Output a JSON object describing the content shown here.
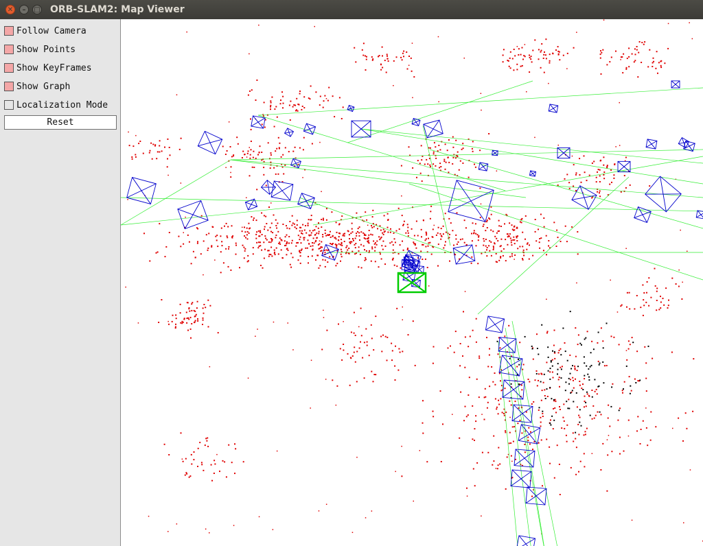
{
  "window": {
    "title": "ORB-SLAM2: Map Viewer"
  },
  "panel": {
    "items": [
      {
        "label": "Follow Camera",
        "checked": true
      },
      {
        "label": "Show Points",
        "checked": true
      },
      {
        "label": "Show KeyFrames",
        "checked": true
      },
      {
        "label": "Show Graph",
        "checked": true
      },
      {
        "label": "Localization Mode",
        "checked": false
      }
    ],
    "reset_label": "Reset"
  },
  "colors": {
    "map_points": "#e00000",
    "reference_points": "#000000",
    "keyframes": "#0000cc",
    "graph": "#33ee33",
    "current_camera": "#00cc00",
    "checkbox_checked": "#f4a7a7"
  }
}
